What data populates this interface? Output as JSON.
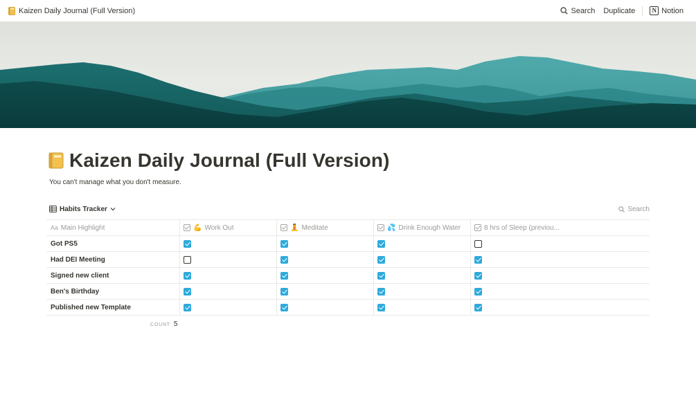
{
  "topbar": {
    "breadcrumb": "Kaizen Daily Journal (Full Version)",
    "breadcrumb_icon": "notebook-icon",
    "search_label": "Search",
    "duplicate_label": "Duplicate",
    "notion_label": "Notion"
  },
  "page": {
    "title": "Kaizen Daily Journal (Full Version)",
    "subtitle": "You can't manage what you don't measure."
  },
  "database": {
    "view_name": "Habits Tracker",
    "search_label": "Search",
    "columns": [
      {
        "label": "Main Highlight",
        "type": "title"
      },
      {
        "label": "Work Out",
        "emoji": "💪",
        "type": "checkbox"
      },
      {
        "label": "Meditate",
        "emoji": "🧘",
        "type": "checkbox"
      },
      {
        "label": "Drink Enough Water",
        "emoji": "💦",
        "type": "checkbox"
      },
      {
        "label": "8 hrs of Sleep (previou...",
        "type": "checkbox"
      }
    ],
    "rows": [
      {
        "highlight": "Got PS5",
        "checks": [
          true,
          true,
          true,
          false
        ]
      },
      {
        "highlight": "Had DEI Meeting",
        "checks": [
          false,
          true,
          true,
          true
        ]
      },
      {
        "highlight": "Signed new client",
        "checks": [
          true,
          true,
          true,
          true
        ]
      },
      {
        "highlight": "Ben's Birthday",
        "checks": [
          true,
          true,
          true,
          true
        ]
      },
      {
        "highlight": "Published new Template",
        "checks": [
          true,
          true,
          true,
          true
        ]
      }
    ],
    "count_label": "COUNT",
    "count_value": "5"
  },
  "colors": {
    "checkbox_on": "#2eaadc",
    "text": "#37352f",
    "muted": "#9b9a97"
  }
}
